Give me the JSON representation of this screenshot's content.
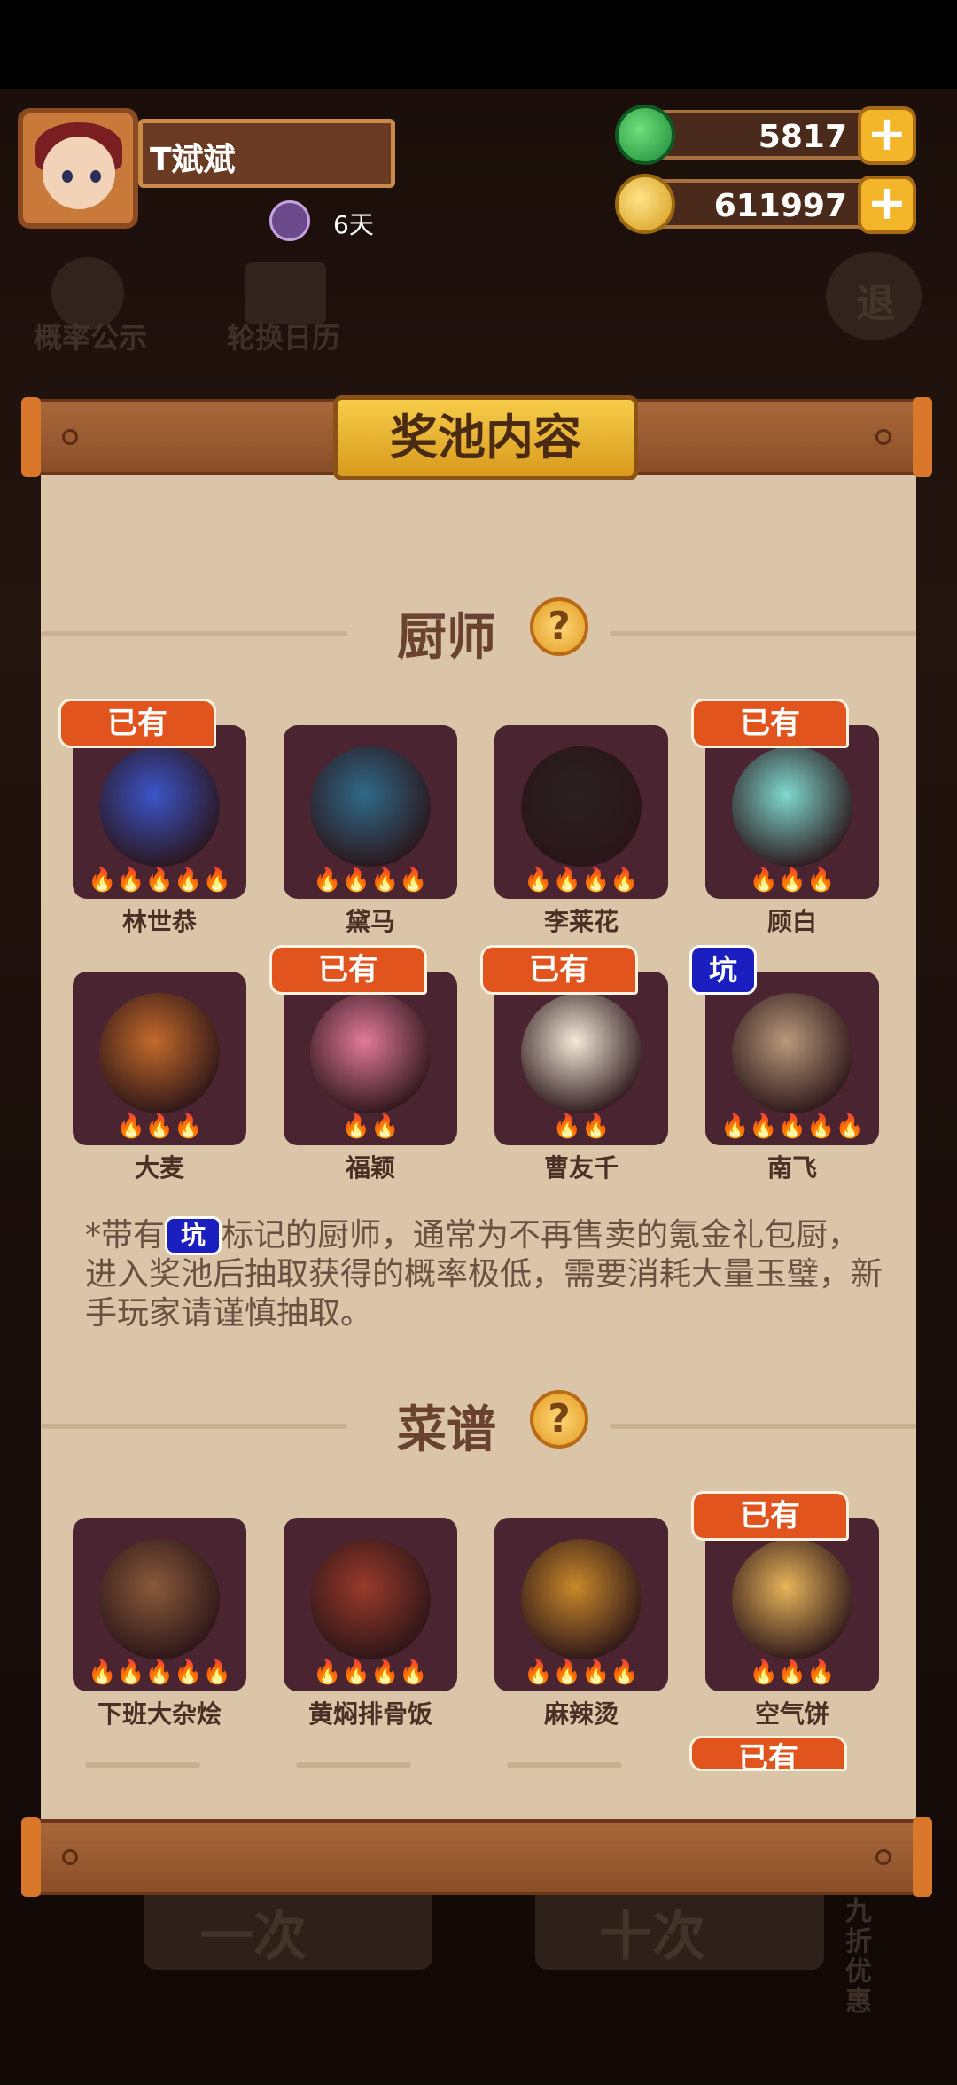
{
  "player": {
    "name": "T斌斌",
    "days": "6天"
  },
  "currency": {
    "jade": "5817",
    "coins": "611997",
    "plus": "+"
  },
  "background": {
    "probability_label": "概率公示",
    "rotation_label": "轮换日历",
    "exit_label": "退",
    "single_draw": "一次",
    "ten_draw": "十次",
    "discount": "九折优惠"
  },
  "panel": {
    "title": "奖池内容",
    "help_symbol": "?",
    "chef_section": "厨师",
    "recipe_section": "菜谱",
    "owned_label": "已有",
    "pit_label": "坑",
    "note_prefix": "*带有",
    "note_suffix": "标记的厨师，通常为不再售卖的氪金礼包厨，进入奖池后抽取获得的概率极低，需要消耗大量玉璧，新手玩家请谨慎抽取。"
  },
  "chefs": [
    {
      "name": "林世恭",
      "flames": "🔥🔥🔥🔥🔥",
      "owned": true,
      "pit": false,
      "color": "#3b55c9"
    },
    {
      "name": "黛马",
      "flames": "🔥🔥🔥🔥",
      "owned": false,
      "pit": false,
      "color": "#2f6a8a"
    },
    {
      "name": "李莱花",
      "flames": "🔥🔥🔥🔥",
      "owned": false,
      "pit": false,
      "color": "#2a2222"
    },
    {
      "name": "顾白",
      "flames": "🔥🔥🔥",
      "owned": true,
      "pit": false,
      "color": "#7fd9cf"
    },
    {
      "name": "大麦",
      "flames": "🔥🔥🔥",
      "owned": false,
      "pit": false,
      "color": "#c46a2a"
    },
    {
      "name": "福颖",
      "flames": "🔥🔥",
      "owned": true,
      "pit": false,
      "color": "#e37a9a"
    },
    {
      "name": "曹友千",
      "flames": "🔥🔥",
      "owned": true,
      "pit": false,
      "color": "#f3ead8"
    },
    {
      "name": "南飞",
      "flames": "🔥🔥🔥🔥🔥",
      "owned": false,
      "pit": true,
      "color": "#b89a7a"
    }
  ],
  "recipes": [
    {
      "name": "下班大杂烩",
      "flames": "🔥🔥🔥🔥🔥",
      "owned": false,
      "color": "#8a5a3a"
    },
    {
      "name": "黄焖排骨饭",
      "flames": "🔥🔥🔥🔥",
      "owned": false,
      "color": "#9a3a2a"
    },
    {
      "name": "麻辣烫",
      "flames": "🔥🔥🔥🔥",
      "owned": false,
      "color": "#c9882a"
    },
    {
      "name": "空气饼",
      "flames": "🔥🔥🔥",
      "owned": true,
      "color": "#e8b45a"
    }
  ]
}
